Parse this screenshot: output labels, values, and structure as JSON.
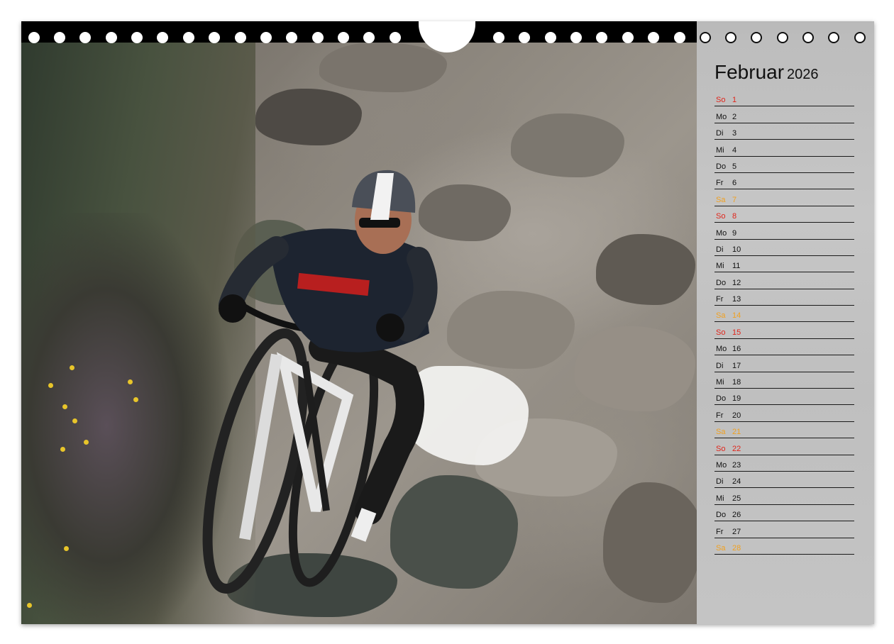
{
  "calendar": {
    "month": "Februar",
    "year": "2026",
    "days": [
      {
        "wd": "So",
        "d": "1",
        "type": "sun"
      },
      {
        "wd": "Mo",
        "d": "2",
        "type": ""
      },
      {
        "wd": "Di",
        "d": "3",
        "type": ""
      },
      {
        "wd": "Mi",
        "d": "4",
        "type": ""
      },
      {
        "wd": "Do",
        "d": "5",
        "type": ""
      },
      {
        "wd": "Fr",
        "d": "6",
        "type": ""
      },
      {
        "wd": "Sa",
        "d": "7",
        "type": "sat"
      },
      {
        "wd": "So",
        "d": "8",
        "type": "sun"
      },
      {
        "wd": "Mo",
        "d": "9",
        "type": ""
      },
      {
        "wd": "Di",
        "d": "10",
        "type": ""
      },
      {
        "wd": "Mi",
        "d": "11",
        "type": ""
      },
      {
        "wd": "Do",
        "d": "12",
        "type": ""
      },
      {
        "wd": "Fr",
        "d": "13",
        "type": ""
      },
      {
        "wd": "Sa",
        "d": "14",
        "type": "sat"
      },
      {
        "wd": "So",
        "d": "15",
        "type": "sun"
      },
      {
        "wd": "Mo",
        "d": "16",
        "type": ""
      },
      {
        "wd": "Di",
        "d": "17",
        "type": ""
      },
      {
        "wd": "Mi",
        "d": "18",
        "type": ""
      },
      {
        "wd": "Do",
        "d": "19",
        "type": ""
      },
      {
        "wd": "Fr",
        "d": "20",
        "type": ""
      },
      {
        "wd": "Sa",
        "d": "21",
        "type": "sat"
      },
      {
        "wd": "So",
        "d": "22",
        "type": "sun"
      },
      {
        "wd": "Mo",
        "d": "23",
        "type": ""
      },
      {
        "wd": "Di",
        "d": "24",
        "type": ""
      },
      {
        "wd": "Mi",
        "d": "25",
        "type": ""
      },
      {
        "wd": "Do",
        "d": "26",
        "type": ""
      },
      {
        "wd": "Fr",
        "d": "27",
        "type": ""
      },
      {
        "wd": "Sa",
        "d": "28",
        "type": "sat"
      }
    ]
  },
  "colors": {
    "sunday": "#e0251b",
    "saturday": "#f0a020",
    "binding": "#000000",
    "panel": "#c2c2c2"
  }
}
